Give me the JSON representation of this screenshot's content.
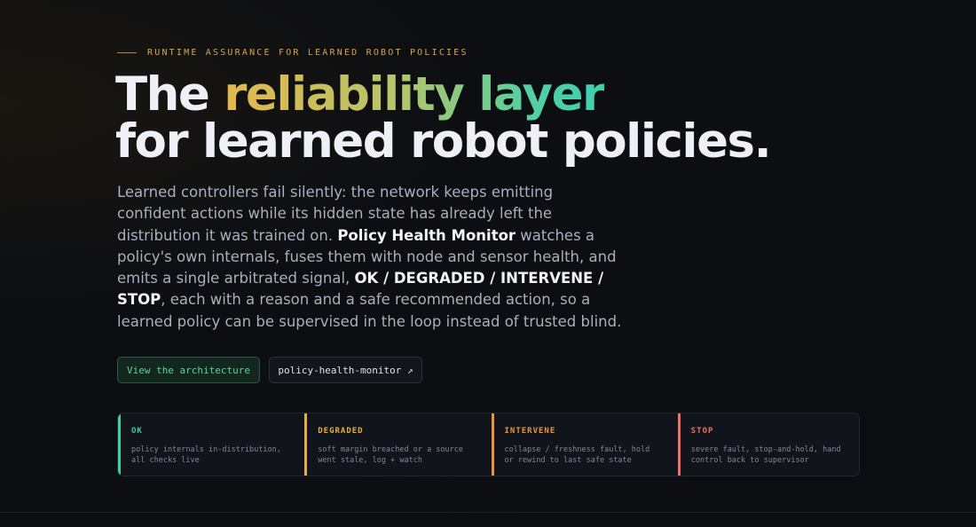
{
  "hero": {
    "eyebrow": "RUNTIME ASSURANCE FOR LEARNED ROBOT POLICIES",
    "title_pre": "The ",
    "title_highlight": "reliability layer",
    "title_line2": "for learned robot policies.",
    "lead": {
      "p1": "Learned controllers fail silently: the network keeps emitting confident actions while its hidden state has already left the distribution it was trained on. ",
      "product": "Policy Health Monitor",
      "p2": " watches a policy's own internals, fuses them with node and sensor health, and emits a single arbitrated signal, ",
      "signals": "OK / DEGRADED / INTERVENE / STOP",
      "p3": ", each with a reason and a safe recommended action, so a learned policy can be supervised in the loop instead of trusted blind."
    }
  },
  "buttons": {
    "primary": "View the architecture",
    "secondary": "policy-health-monitor ↗"
  },
  "states": [
    {
      "title": "OK",
      "desc": "policy internals in-distribution, all checks live",
      "color": "#3ecfa5"
    },
    {
      "title": "DEGRADED",
      "desc": "soft margin breached or a source went stale, log + watch",
      "color": "#e6ad44"
    },
    {
      "title": "INTERVENE",
      "desc": "collapse / freshness fault, hold or rewind to last safe state",
      "color": "#e7963f"
    },
    {
      "title": "STOP",
      "desc": "severe fault, stop-and-hold, hand control back to supervisor",
      "color": "#ee6f6a"
    }
  ]
}
